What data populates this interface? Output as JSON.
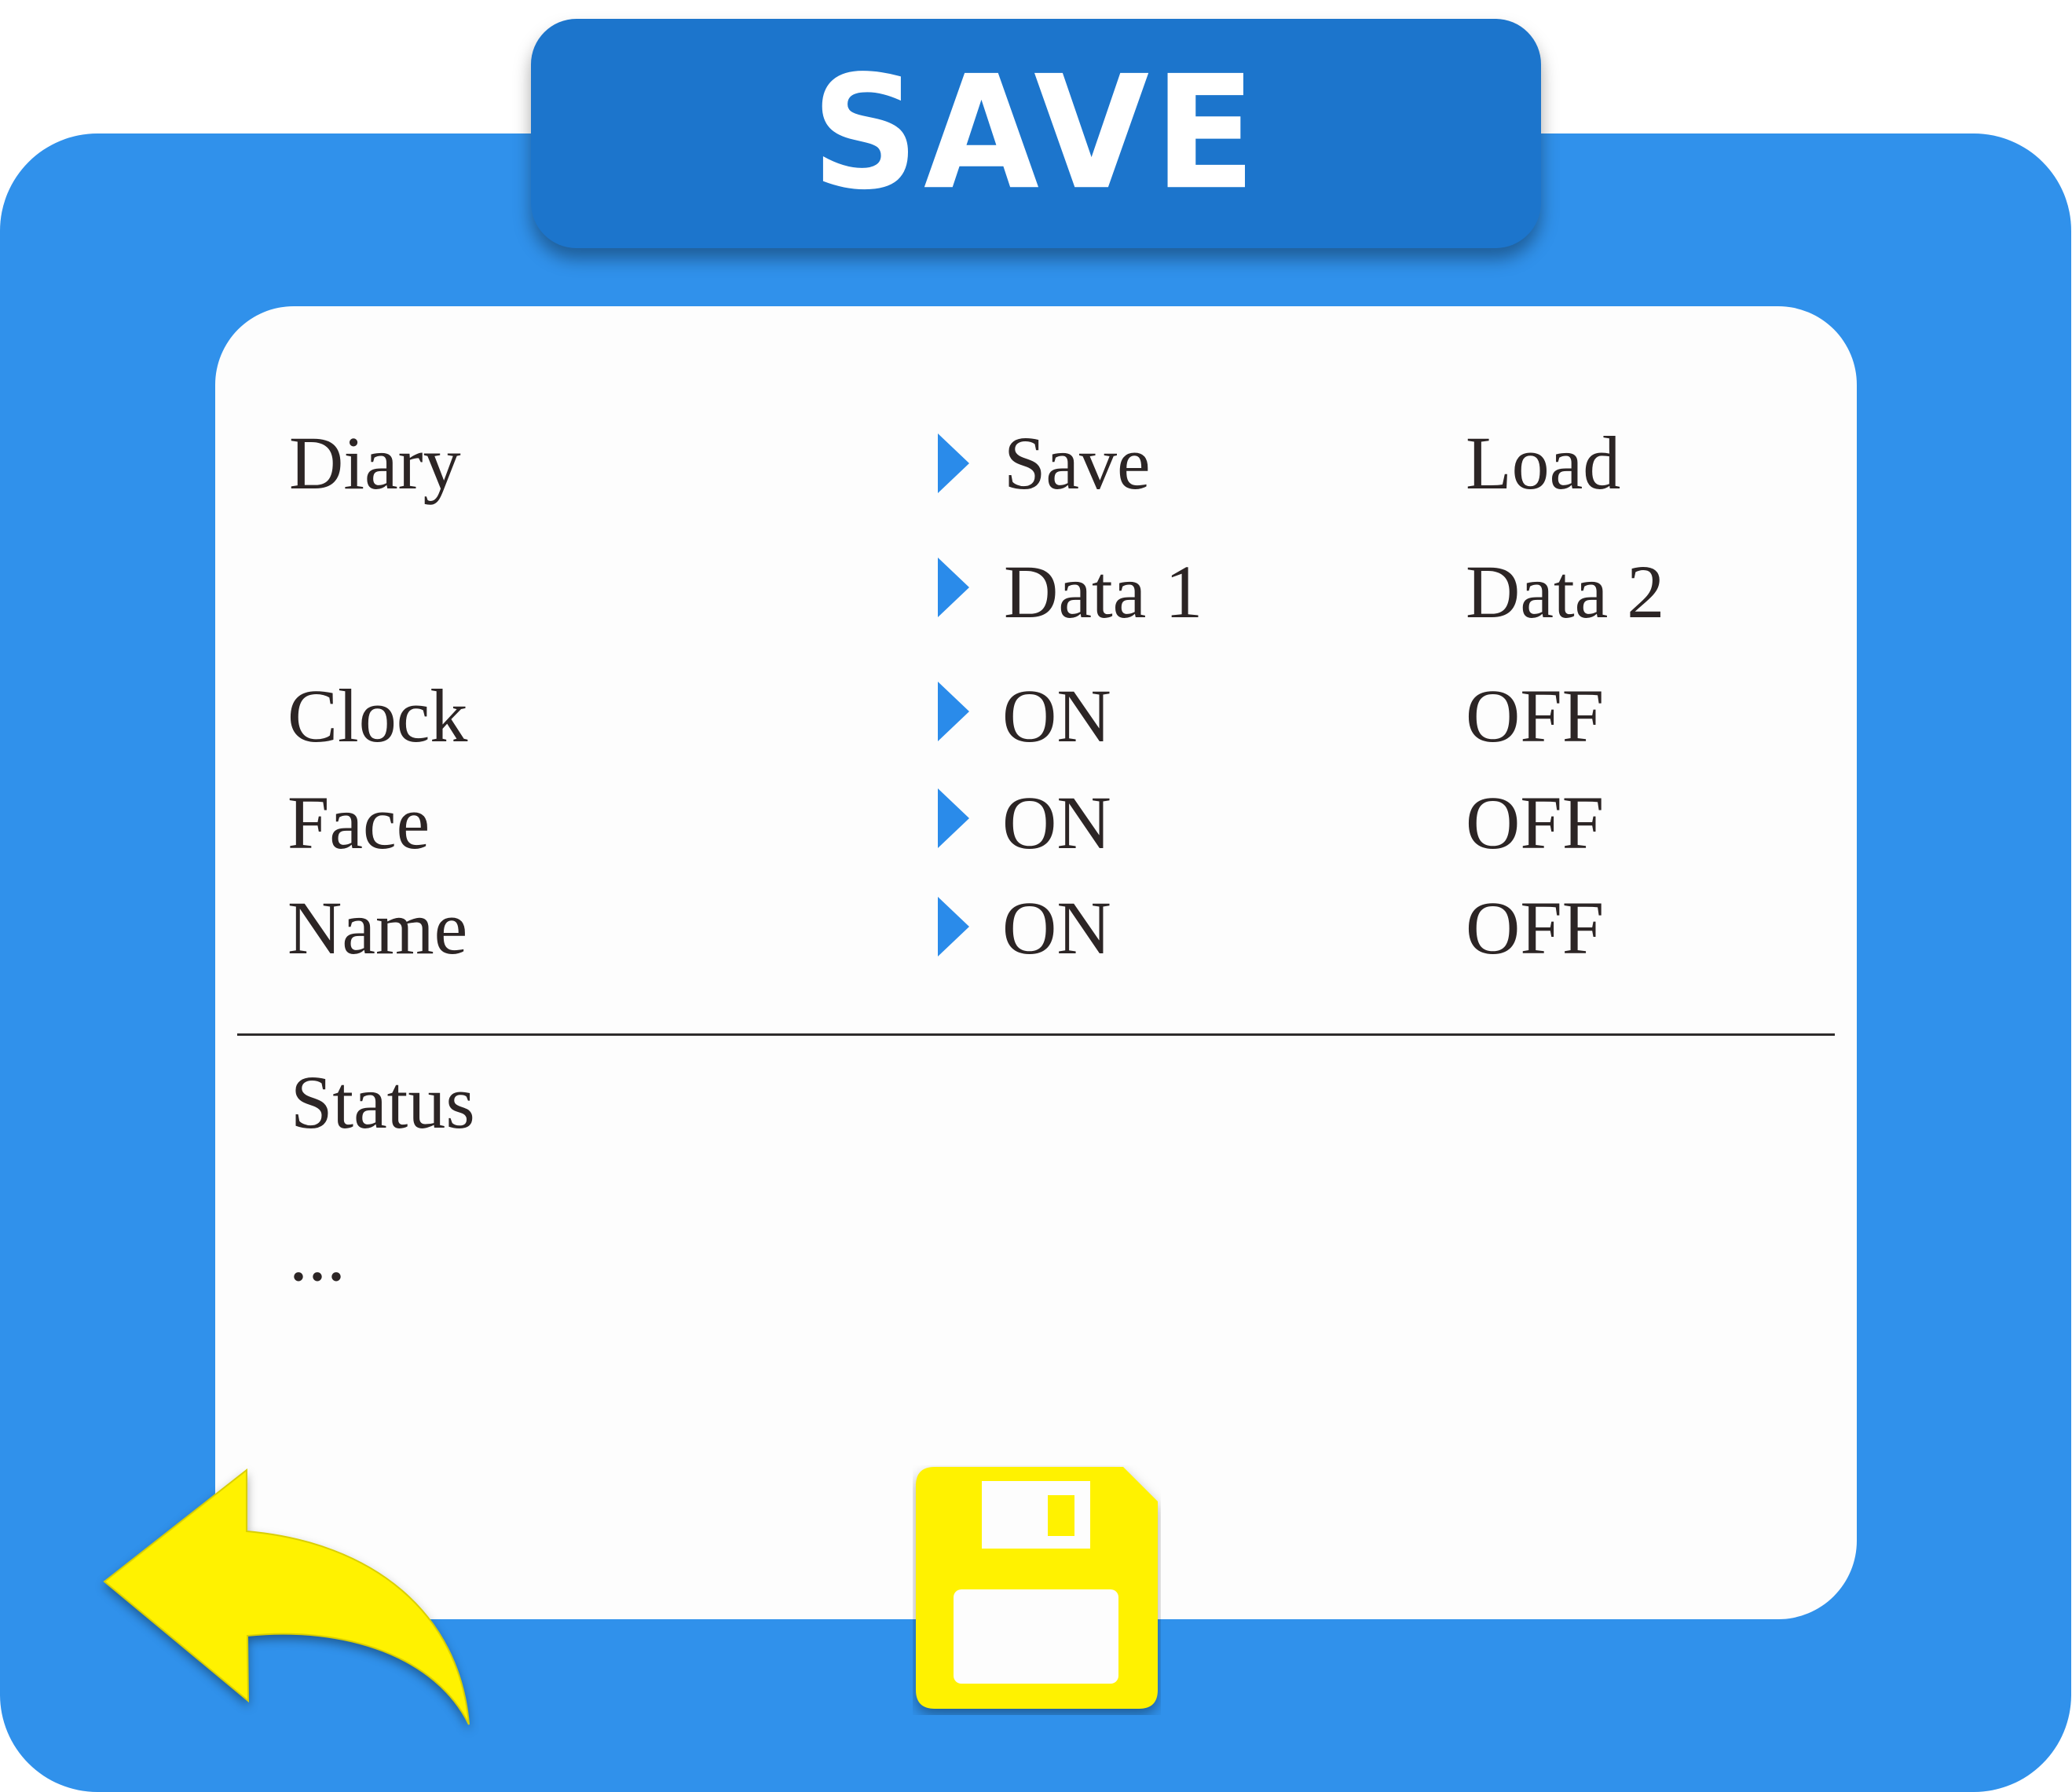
{
  "title": "SAVE",
  "options": {
    "diary": {
      "label": "Diary",
      "choice_a": "Save",
      "choice_b": "Load",
      "selected": "choice_a"
    },
    "data": {
      "label": "",
      "choice_a": "Data 1",
      "choice_b": "Data 2",
      "selected": "choice_a"
    },
    "clock": {
      "label": "Clock",
      "choice_a": "ON",
      "choice_b": "OFF",
      "selected": "choice_a"
    },
    "face": {
      "label": "Face",
      "choice_a": "ON",
      "choice_b": "OFF",
      "selected": "choice_a"
    },
    "name": {
      "label": "Name",
      "choice_a": "ON",
      "choice_b": "OFF",
      "selected": "choice_a"
    }
  },
  "status": {
    "label": "Status",
    "text": "..."
  },
  "icons": {
    "selection": "triangle-right-icon",
    "back": "back-arrow-icon",
    "save": "floppy-disk-icon"
  },
  "colors": {
    "frame": "#3091eb",
    "title_tab": "#1c75cc",
    "panel": "#fdfdfd",
    "selector": "#2a8bea",
    "action_icons": "#fff200",
    "text": "#2c2525"
  }
}
